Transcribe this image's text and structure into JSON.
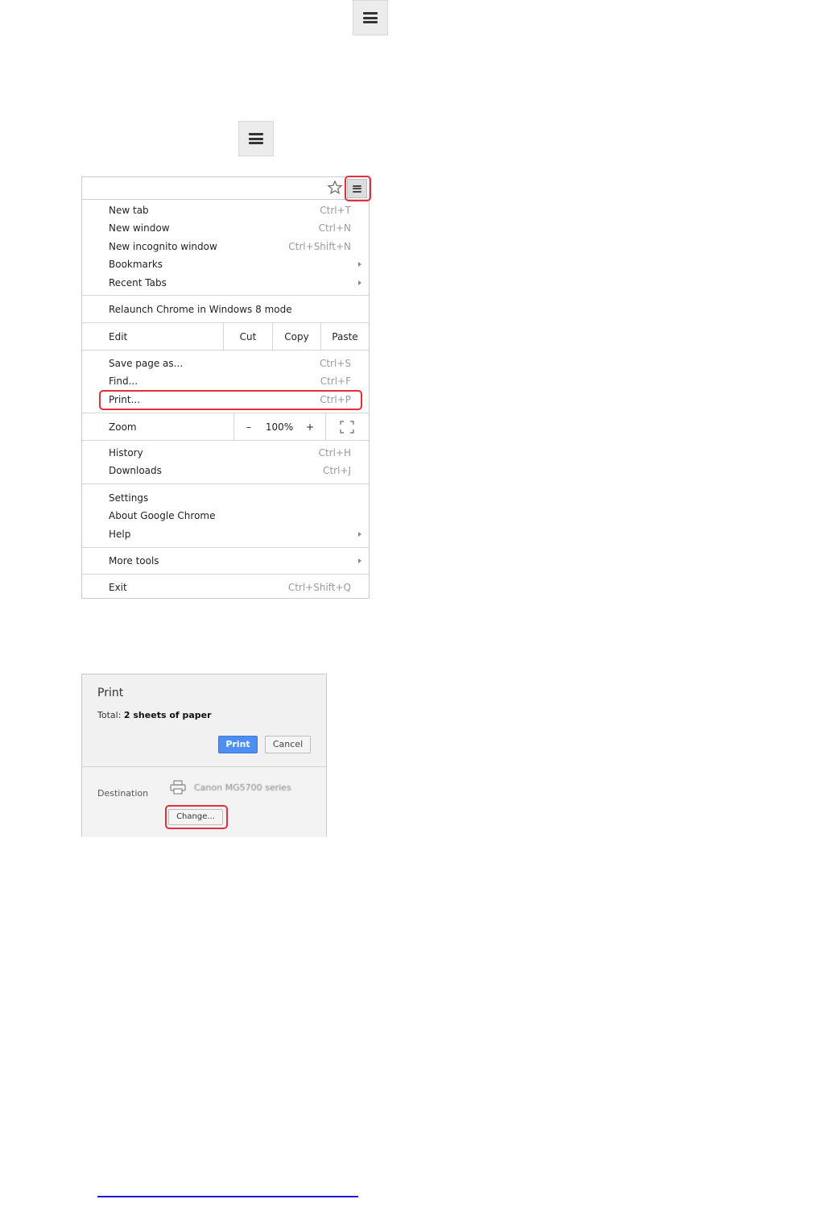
{
  "menu": {
    "items_group1": [
      {
        "label": "New tab",
        "shortcut": "Ctrl+T"
      },
      {
        "label": "New window",
        "shortcut": "Ctrl+N"
      },
      {
        "label": "New incognito window",
        "shortcut": "Ctrl+Shift+N"
      },
      {
        "label": "Bookmarks",
        "submenu": true
      },
      {
        "label": "Recent Tabs",
        "submenu": true
      }
    ],
    "relaunch": "Relaunch Chrome in Windows 8 mode",
    "edit_row": {
      "label": "Edit",
      "cut": "Cut",
      "copy": "Copy",
      "paste": "Paste"
    },
    "items_group3": [
      {
        "label": "Save page as...",
        "shortcut": "Ctrl+S"
      },
      {
        "label": "Find...",
        "shortcut": "Ctrl+F"
      },
      {
        "label": "Print...",
        "shortcut": "Ctrl+P"
      }
    ],
    "zoom_row": {
      "label": "Zoom",
      "minus": "–",
      "value": "100%",
      "plus": "+"
    },
    "items_group5": [
      {
        "label": "History",
        "shortcut": "Ctrl+H"
      },
      {
        "label": "Downloads",
        "shortcut": "Ctrl+J"
      }
    ],
    "items_group6": [
      {
        "label": "Settings"
      },
      {
        "label": "About Google Chrome"
      },
      {
        "label": "Help",
        "submenu": true
      }
    ],
    "more_tools": "More tools",
    "exit": {
      "label": "Exit",
      "shortcut": "Ctrl+Shift+Q"
    }
  },
  "print_dialog": {
    "title": "Print",
    "total_prefix": "Total:",
    "total_value": "2 sheets of paper",
    "print_button": "Print",
    "cancel_button": "Cancel",
    "destination_label": "Destination",
    "printer_name": "Canon MG5700 series",
    "change_button": "Change..."
  },
  "colors": {
    "highlight": "#e0303c",
    "primary_button": "#4d8ef3",
    "link": "#1a1adb"
  }
}
